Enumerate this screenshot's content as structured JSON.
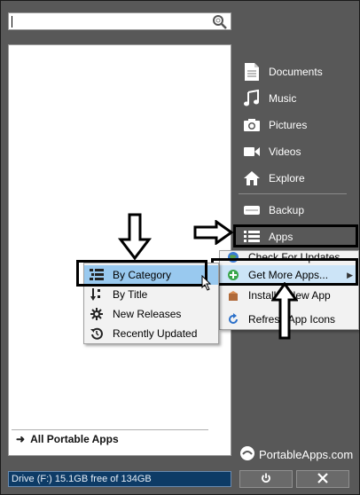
{
  "search": {
    "value": "",
    "icon": "search-icon"
  },
  "app_list": {
    "all_apps_label": "All Portable Apps"
  },
  "drive": {
    "text": "Drive (F:) 15.1GB free of 134GB"
  },
  "right_menu": {
    "items": [
      {
        "label": "Documents",
        "icon": "document-icon"
      },
      {
        "label": "Music",
        "icon": "music-note-icon"
      },
      {
        "label": "Pictures",
        "icon": "camera-icon"
      },
      {
        "label": "Videos",
        "icon": "video-camera-icon"
      },
      {
        "label": "Explore",
        "icon": "house-icon"
      },
      {
        "label": "Backup",
        "icon": "backup-drive-icon"
      },
      {
        "label": "Apps",
        "icon": "list-icon"
      }
    ]
  },
  "apps_menu": {
    "items": [
      {
        "label": "Check For Updates",
        "icon": "globe-icon"
      },
      {
        "label": "Get More Apps...",
        "icon": "plus-circle-icon"
      },
      {
        "label": "Install a New App",
        "icon": "package-icon"
      },
      {
        "label": "Refresh App Icons",
        "icon": "refresh-icon"
      }
    ]
  },
  "category_menu": {
    "items": [
      {
        "label": "By Category",
        "icon": "category-list-icon"
      },
      {
        "label": "By Title",
        "icon": "sort-alpha-icon"
      },
      {
        "label": "New Releases",
        "icon": "starburst-icon"
      },
      {
        "label": "Recently Updated",
        "icon": "history-icon"
      }
    ]
  },
  "footer": {
    "logo_text": "PortableApps.com",
    "power_icon": "power-icon",
    "close_icon": "close-icon"
  },
  "colors": {
    "background": "#585858",
    "drive_bar": "#0d3b66",
    "highlight": "#99c9ef"
  }
}
